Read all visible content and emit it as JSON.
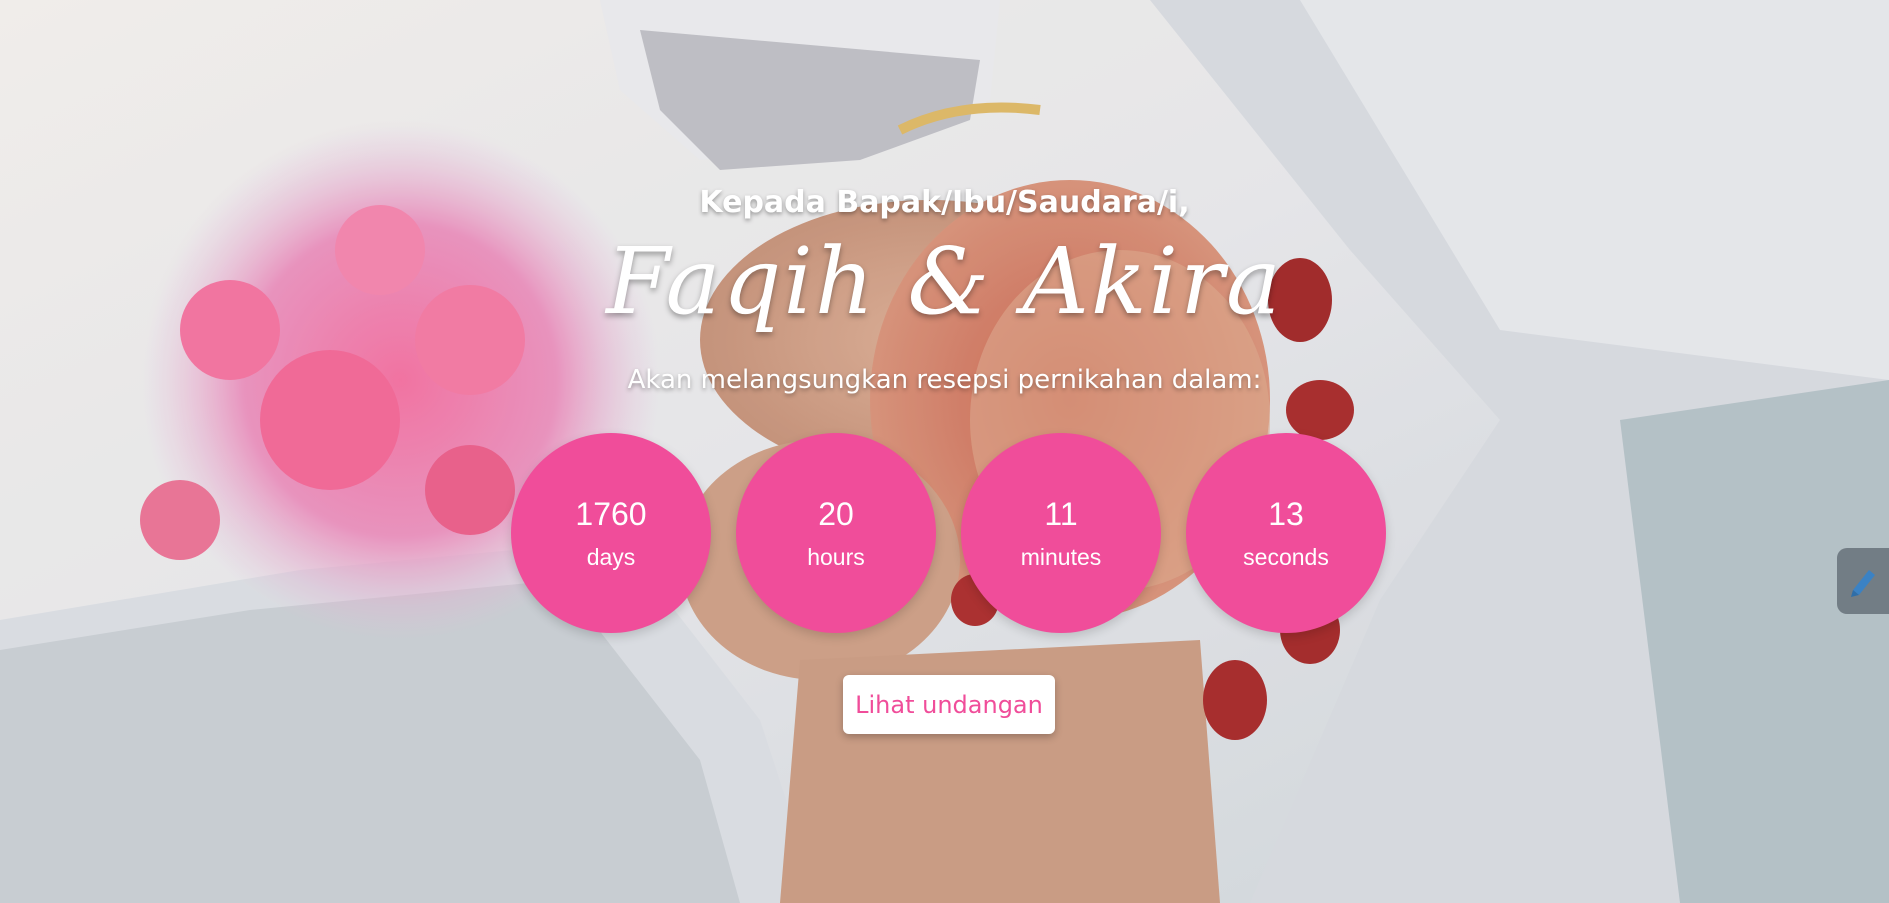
{
  "hero": {
    "greeting": "Kepada Bapak/Ibu/Saudara/i,",
    "couple_names": "Faqih & Akira",
    "subtitle": "Akan melangsungkan resepsi pernikahan dalam:"
  },
  "countdown": [
    {
      "value": "1760",
      "unit": "days"
    },
    {
      "value": "20",
      "unit": "hours"
    },
    {
      "value": "11",
      "unit": "minutes"
    },
    {
      "value": "13",
      "unit": "seconds"
    }
  ],
  "cta": {
    "label": "Lihat undangan"
  },
  "colors": {
    "accent": "#f04d9a",
    "text_light": "#ffffff"
  },
  "icons": {
    "side_widget": "edit-icon"
  }
}
